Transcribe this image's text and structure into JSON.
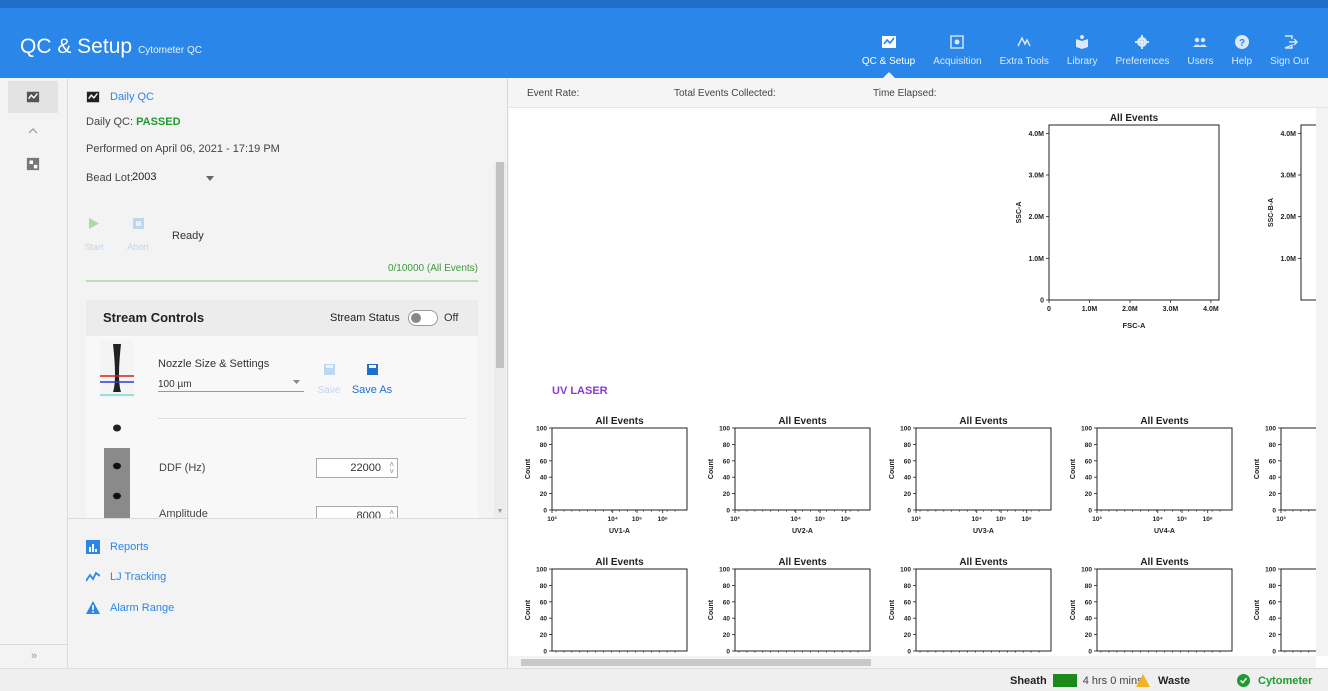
{
  "header": {
    "title": "QC & Setup",
    "subtitle": "Cytometer QC",
    "nav": [
      {
        "label": "QC & Setup",
        "icon": "qc-icon"
      },
      {
        "label": "Acquisition",
        "icon": "acquisition-icon"
      },
      {
        "label": "Extra Tools",
        "icon": "extra-tools-icon"
      },
      {
        "label": "Library",
        "icon": "library-icon"
      },
      {
        "label": "Preferences",
        "icon": "gear-icon"
      },
      {
        "label": "Users",
        "icon": "users-icon"
      },
      {
        "label": "Help",
        "icon": "help-icon"
      },
      {
        "label": "Sign Out",
        "icon": "sign-out-icon"
      }
    ],
    "active_nav": "QC & Setup"
  },
  "rail": {
    "expand_label": "»",
    "collapse_label": "^"
  },
  "daily_qc": {
    "title": "Daily QC",
    "status_label": "Daily QC:",
    "status_value": "PASSED",
    "performed": "Performed on April 06, 2021 - 17:19 PM",
    "bead_lot_label": "Bead Lot:",
    "bead_lot_value": "2003",
    "start_label": "Start",
    "abort_label": "Abort",
    "state": "Ready",
    "progress_text": "0/10000 (All Events)"
  },
  "stream_controls": {
    "title": "Stream Controls",
    "status_label": "Stream Status",
    "status_value": "Off",
    "nozzle_label": "Nozzle Size & Settings",
    "nozzle_value": "100 µm",
    "save_label": "Save",
    "save_as_label": "Save As",
    "ddf_label": "DDF (Hz)",
    "ddf_value": "22000",
    "amplitude_label": "Amplitude",
    "amplitude_value": "8000"
  },
  "side_links": [
    {
      "label": "Reports",
      "icon": "reports-icon"
    },
    {
      "label": "LJ Tracking",
      "icon": "tracking-icon"
    },
    {
      "label": "Alarm Range",
      "icon": "alarm-icon"
    }
  ],
  "stats": {
    "event_rate_label": "Event Rate:",
    "total_events_label": "Total Events Collected:",
    "time_elapsed_label": "Time Elapsed:"
  },
  "uv_laser_label": "UV LASER",
  "footer": {
    "sheath_label": "Sheath",
    "sheath_color": "#1a8a1a",
    "sheath_time": "4 hrs 0 mins",
    "waste_label": "Waste",
    "cytometer_label": "Cytometer"
  },
  "chart_data": [
    {
      "type": "scatter",
      "title": "All Events",
      "xlabel": "FSC-A",
      "ylabel": "SSC-A",
      "xticks": [
        "0",
        "1.0M",
        "2.0M",
        "3.0M",
        "4.0M"
      ],
      "yticks": [
        "0",
        "1.0M",
        "2.0M",
        "3.0M",
        "4.0M"
      ],
      "values": []
    },
    {
      "type": "scatter",
      "title": "",
      "xlabel": "",
      "ylabel": "SSC-B-A",
      "yticks": [
        "1.0M",
        "2.0M",
        "3.0M",
        "4.0M"
      ],
      "values": []
    },
    {
      "type": "bar",
      "title": "All Events",
      "xlabel": "UV1-A",
      "ylabel": "Count",
      "yticks": [
        "0",
        "20",
        "40",
        "60",
        "80",
        "100"
      ],
      "xticks": [
        "10³",
        "10⁴",
        "10⁵",
        "10⁶"
      ],
      "values": []
    },
    {
      "type": "bar",
      "title": "All Events",
      "xlabel": "UV2-A",
      "ylabel": "Count",
      "yticks": [
        "0",
        "20",
        "40",
        "60",
        "80",
        "100"
      ],
      "xticks": [
        "10³",
        "10⁴",
        "10⁵",
        "10⁶"
      ],
      "values": []
    },
    {
      "type": "bar",
      "title": "All Events",
      "xlabel": "UV3-A",
      "ylabel": "Count",
      "yticks": [
        "0",
        "20",
        "40",
        "60",
        "80",
        "100"
      ],
      "xticks": [
        "10³",
        "10⁴",
        "10⁵",
        "10⁶"
      ],
      "values": []
    },
    {
      "type": "bar",
      "title": "All Events",
      "xlabel": "UV4-A",
      "ylabel": "Count",
      "yticks": [
        "0",
        "20",
        "40",
        "60",
        "80",
        "100"
      ],
      "xticks": [
        "10³",
        "10⁴",
        "10⁵",
        "10⁶"
      ],
      "values": []
    },
    {
      "type": "bar",
      "title": "",
      "xlabel": "",
      "ylabel": "Count",
      "yticks": [
        "0",
        "20",
        "40",
        "60",
        "80",
        "100"
      ],
      "xticks": [
        "10³"
      ],
      "values": []
    },
    {
      "type": "bar",
      "title": "All Events",
      "xlabel": "",
      "ylabel": "Count",
      "yticks": [
        "0",
        "20",
        "40",
        "60",
        "80",
        "100"
      ],
      "values": []
    },
    {
      "type": "bar",
      "title": "All Events",
      "xlabel": "",
      "ylabel": "Count",
      "yticks": [
        "0",
        "20",
        "40",
        "60",
        "80",
        "100"
      ],
      "values": []
    },
    {
      "type": "bar",
      "title": "All Events",
      "xlabel": "",
      "ylabel": "Count",
      "yticks": [
        "0",
        "20",
        "40",
        "60",
        "80",
        "100"
      ],
      "values": []
    },
    {
      "type": "bar",
      "title": "All Events",
      "xlabel": "",
      "ylabel": "Count",
      "yticks": [
        "0",
        "20",
        "40",
        "60",
        "80",
        "100"
      ],
      "values": []
    },
    {
      "type": "bar",
      "title": "",
      "xlabel": "",
      "ylabel": "Count",
      "yticks": [
        "0",
        "20",
        "40",
        "60",
        "80",
        "100"
      ],
      "values": []
    }
  ]
}
